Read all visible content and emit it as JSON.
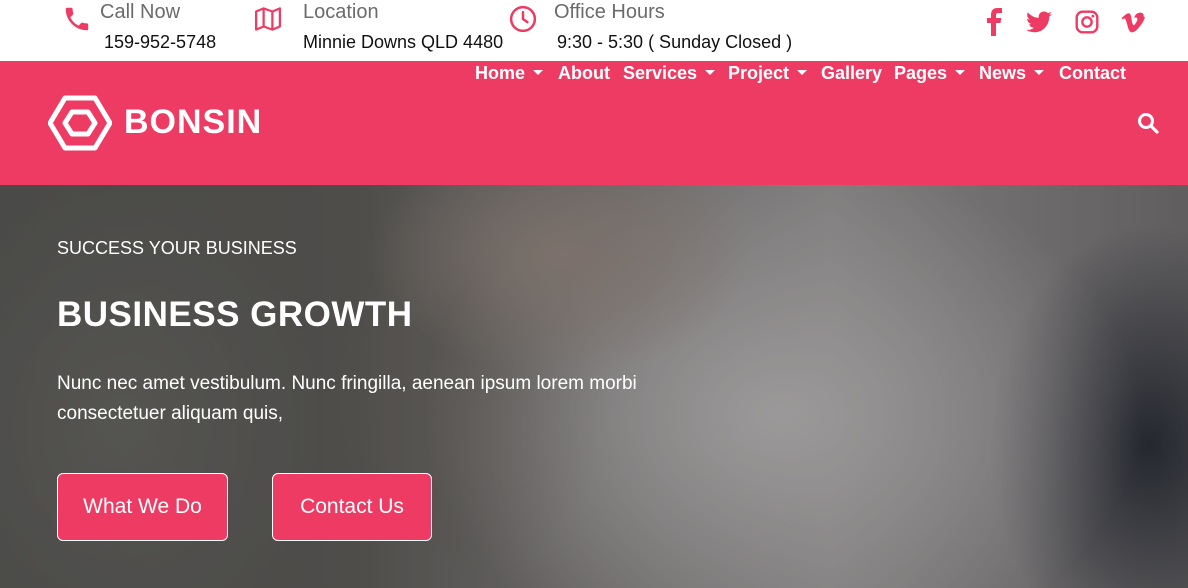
{
  "topbar": {
    "call": {
      "title": "Call Now",
      "value": "159-952-5748",
      "icon": "phone-icon"
    },
    "location": {
      "title": "Location",
      "value": "Minnie Downs QLD 4480",
      "icon": "map-icon"
    },
    "hours": {
      "title": "Office Hours",
      "value": "9:30 - 5:30 ( Sunday Closed )",
      "icon": "clock-icon"
    },
    "social": [
      "facebook-icon",
      "twitter-icon",
      "instagram-icon",
      "vimeo-icon"
    ]
  },
  "header": {
    "logo": "BONSIN",
    "nav": {
      "home": "Home",
      "about": "About",
      "services": "Services",
      "project": "Project",
      "gallery": "Gallery",
      "pages": "Pages",
      "news": "News",
      "contact": "Contact"
    },
    "search_icon": "search-icon"
  },
  "hero": {
    "subtitle": "SUCCESS YOUR BUSINESS",
    "title": "BUSINESS GROWTH",
    "description": "Nunc nec amet vestibulum. Nunc fringilla, aenean ipsum lorem morbi consectetuer aliquam quis,",
    "button_primary": "What We Do",
    "button_secondary": "Contact Us"
  },
  "colors": {
    "accent": "#ee3b63",
    "text_dark": "#111111",
    "text_muted": "#6b6b6b"
  }
}
